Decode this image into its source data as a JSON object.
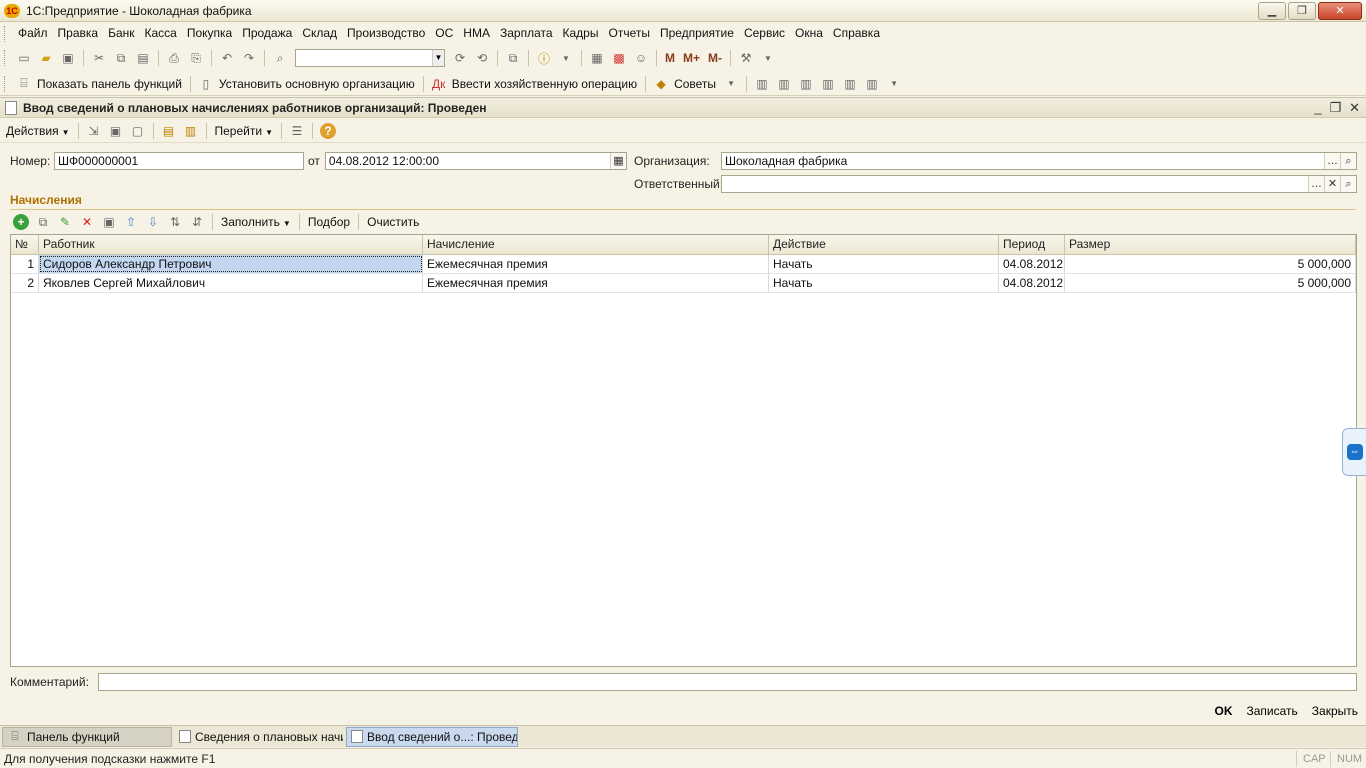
{
  "window": {
    "title": "1С:Предприятие - Шоколадная фабрика",
    "logo": "1С",
    "minimize": "▁",
    "maximize": "❐",
    "close": "✕"
  },
  "menu": {
    "items": [
      {
        "label": "Файл"
      },
      {
        "label": "Правка"
      },
      {
        "label": "Банк"
      },
      {
        "label": "Касса"
      },
      {
        "label": "Покупка"
      },
      {
        "label": "Продажа"
      },
      {
        "label": "Склад"
      },
      {
        "label": "Производство"
      },
      {
        "label": "ОС"
      },
      {
        "label": "НМА"
      },
      {
        "label": "Зарплата"
      },
      {
        "label": "Кадры"
      },
      {
        "label": "Отчеты"
      },
      {
        "label": "Предприятие"
      },
      {
        "label": "Сервис"
      },
      {
        "label": "Окна"
      },
      {
        "label": "Справка"
      }
    ]
  },
  "toolbar1": {
    "m": "M",
    "m_plus": "M+",
    "m_minus": "M-"
  },
  "toolbar2": {
    "show_panel": "Показать панель функций",
    "set_org": "Установить основную организацию",
    "enter_operation": "Ввести хозяйственную операцию",
    "tips": "Советы"
  },
  "document": {
    "title": "Ввод сведений о плановых начислениях работников организаций: Проведен",
    "actions_label": "Действия",
    "goto_label": "Перейти",
    "number_label": "Номер:",
    "number_value": "ШФ000000001",
    "date_label": "от",
    "date_value": "04.08.2012 12:00:00",
    "org_label": "Организация:",
    "org_value": "Шоколадная фабрика",
    "responsible_label": "Ответственный:",
    "responsible_value": "",
    "section_label": "Начисления",
    "fill_label": "Заполнить",
    "pick_label": "Подбор",
    "clear_label": "Очистить",
    "comment_label": "Комментарий:",
    "comment_value": "",
    "ok_label": "OK",
    "save_label": "Записать",
    "close_label": "Закрыть"
  },
  "table": {
    "columns": [
      "№",
      "Работник",
      "Начисление",
      "Действие",
      "Период",
      "Размер"
    ],
    "rows": [
      {
        "n": "1",
        "worker": "Сидоров Александр Петрович",
        "accrual": "Ежемесячная премия",
        "action": "Начать",
        "period": "04.08.2012",
        "amount": "5 000,000"
      },
      {
        "n": "2",
        "worker": "Яковлев Сергей Михайлович",
        "accrual": "Ежемесячная премия",
        "action": "Начать",
        "period": "04.08.2012",
        "amount": "5 000,000"
      }
    ]
  },
  "taskbar": {
    "items": [
      {
        "label": "Панель функций"
      },
      {
        "label": "Сведения о плановых начи..."
      },
      {
        "label": "Ввод сведений о...: Проведен"
      }
    ]
  },
  "status": {
    "hint": "Для получения подсказки нажмите F1",
    "cap": "CAP",
    "num": "NUM"
  },
  "colors": {
    "accent": "#b07000",
    "selection": "#c3d7f0",
    "background": "#f6f3e6"
  }
}
